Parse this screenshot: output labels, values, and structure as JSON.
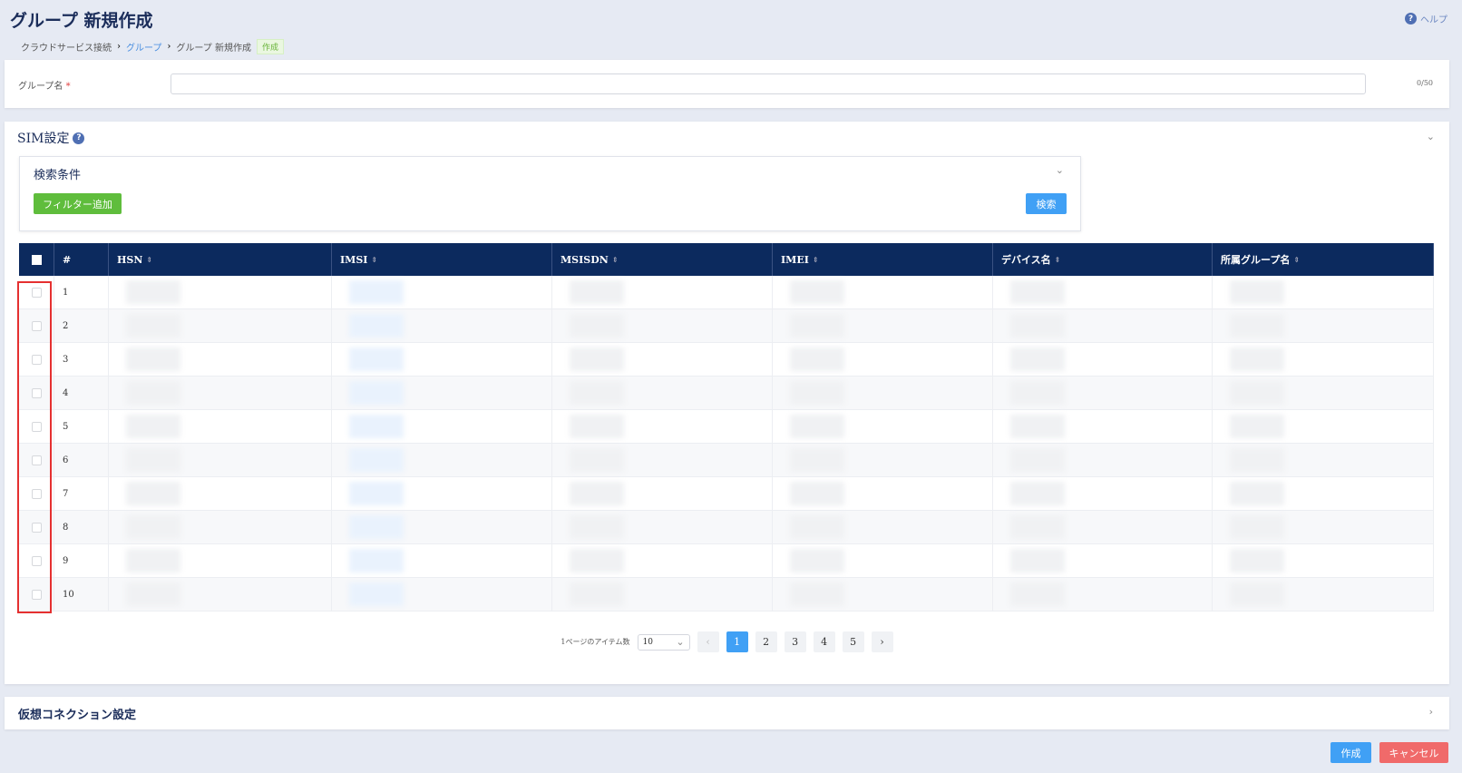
{
  "header": {
    "title": "グループ 新規作成",
    "help": "ヘルプ"
  },
  "breadcrumb": {
    "items": [
      "クラウドサービス接続",
      "グループ",
      "グループ 新規作成"
    ],
    "badge": "作成"
  },
  "group_name": {
    "label": "グループ名",
    "required": "*",
    "value": "",
    "count": "0/50"
  },
  "sim": {
    "title": "SIM設定",
    "search": {
      "title": "検索条件",
      "filter_button": "フィルター追加",
      "search_button": "検索"
    },
    "table": {
      "columns": [
        "#",
        "HSN",
        "IMSI",
        "MSISDN",
        "IMEI",
        "デバイス名",
        "所属グループ名"
      ],
      "rows": [
        "1",
        "2",
        "3",
        "4",
        "5",
        "6",
        "7",
        "8",
        "9",
        "10"
      ]
    },
    "pagination": {
      "per_page_label": "1ページのアイテム数",
      "per_page": "10",
      "pages": [
        "1",
        "2",
        "3",
        "4",
        "5"
      ],
      "current": "1"
    }
  },
  "virtual_connection": {
    "title": "仮想コネクション設定"
  },
  "footer": {
    "create": "作成",
    "cancel": "キャンセル"
  },
  "colors": {
    "header_bg": "#0c2a5e",
    "primary": "#40a0f5",
    "success": "#5fbd3c",
    "danger": "#f06a6a",
    "highlight": "#e53030"
  }
}
